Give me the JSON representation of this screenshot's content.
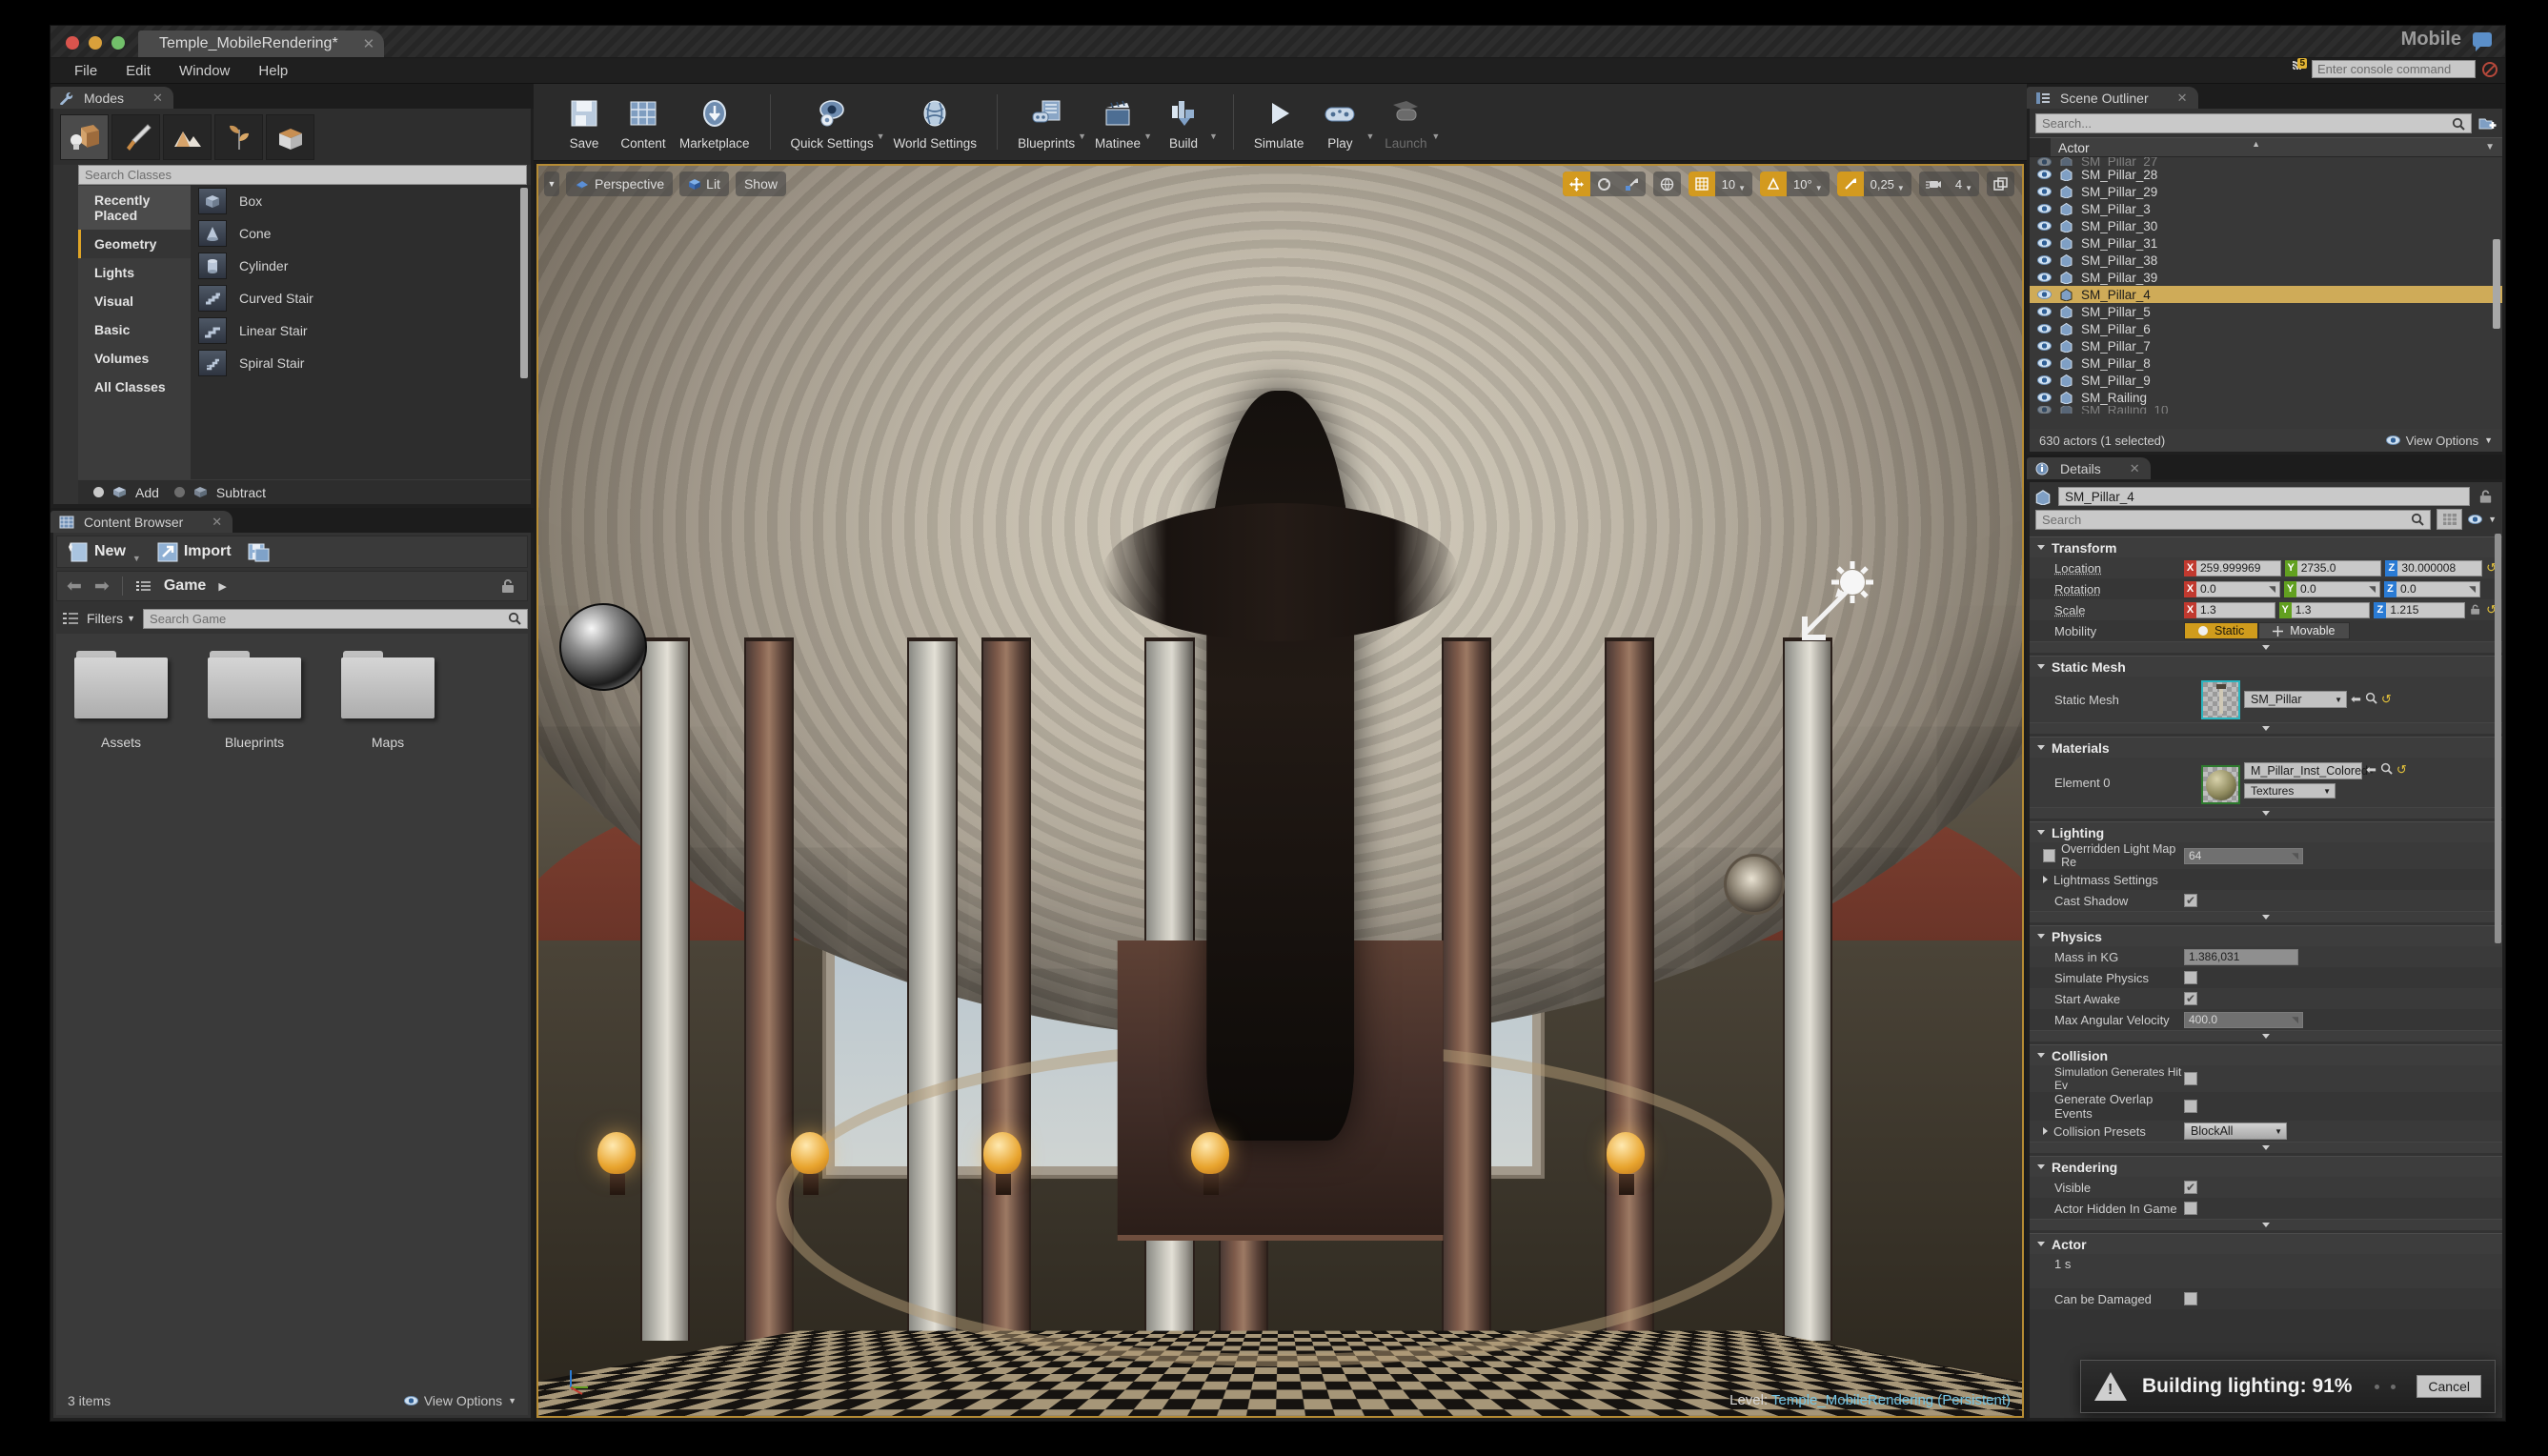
{
  "window": {
    "project_tab": "Temple_MobileRendering*",
    "close_glyph": "✕",
    "mobile_label": "Mobile"
  },
  "menubar": {
    "items": [
      "File",
      "Edit",
      "Window",
      "Help"
    ],
    "network_badge": "5",
    "console_placeholder": "Enter console command"
  },
  "modes": {
    "tab_label": "Modes",
    "search_placeholder": "Search Classes",
    "mode_icons": [
      "place-mode-icon",
      "paint-mode-icon",
      "landscape-mode-icon",
      "foliage-mode-icon",
      "geometry-editing-mode-icon"
    ],
    "categories": [
      {
        "label": "Recently Placed",
        "state": "recent"
      },
      {
        "label": "Geometry",
        "state": "selected"
      },
      {
        "label": "Lights",
        "state": "normal"
      },
      {
        "label": "Visual",
        "state": "normal"
      },
      {
        "label": "Basic",
        "state": "normal"
      },
      {
        "label": "Volumes",
        "state": "normal"
      },
      {
        "label": "All Classes",
        "state": "normal"
      }
    ],
    "items": [
      {
        "label": "Box"
      },
      {
        "label": "Cone"
      },
      {
        "label": "Cylinder"
      },
      {
        "label": "Curved Stair"
      },
      {
        "label": "Linear Stair"
      },
      {
        "label": "Spiral Stair"
      }
    ],
    "brush_add": "Add",
    "brush_subtract": "Subtract"
  },
  "content_browser": {
    "tab_label": "Content Browser",
    "new_label": "New",
    "import_label": "Import",
    "save_all_icon": "save-all-icon",
    "breadcrumb": "Game",
    "filters_label": "Filters",
    "search_placeholder": "Search Game",
    "folders": [
      {
        "label": "Assets"
      },
      {
        "label": "Blueprints"
      },
      {
        "label": "Maps"
      }
    ],
    "item_count": "3 items",
    "view_options": "View Options"
  },
  "toolbar": {
    "groups": [
      [
        {
          "label": "Save",
          "icon": "save-icon",
          "caret": false,
          "dim": false
        },
        {
          "label": "Content",
          "icon": "content-icon",
          "caret": false,
          "dim": false
        },
        {
          "label": "Marketplace",
          "icon": "marketplace-icon",
          "caret": false,
          "dim": false
        }
      ],
      [
        {
          "label": "Quick Settings",
          "icon": "quick-settings-icon",
          "caret": true,
          "dim": false
        },
        {
          "label": "World Settings",
          "icon": "world-settings-icon",
          "caret": false,
          "dim": false
        }
      ],
      [
        {
          "label": "Blueprints",
          "icon": "blueprints-icon",
          "caret": true,
          "dim": false
        },
        {
          "label": "Matinee",
          "icon": "matinee-icon",
          "caret": true,
          "dim": false
        },
        {
          "label": "Build",
          "icon": "build-icon",
          "caret": true,
          "dim": false
        }
      ],
      [
        {
          "label": "Simulate",
          "icon": "simulate-icon",
          "caret": false,
          "dim": false
        },
        {
          "label": "Play",
          "icon": "play-icon",
          "caret": true,
          "dim": false
        },
        {
          "label": "Launch",
          "icon": "launch-icon",
          "caret": true,
          "dim": true
        }
      ]
    ]
  },
  "viewport": {
    "view_mode": "Perspective",
    "lighting_mode": "Lit",
    "show_label": "Show",
    "transform_widgets": [
      "translate-gizmo-icon",
      "rotate-gizmo-icon",
      "scale-gizmo-icon"
    ],
    "coord_system": "world-coords-icon",
    "grid_snap_value": "10",
    "rotation_snap_value": "10°",
    "scale_snap_value": "0,25",
    "camera_speed_value": "4",
    "maximize_icon": "maximize-viewport-icon",
    "level_key": "Level:",
    "level_value": "Temple_MobileRendering (Persistent)"
  },
  "outliner": {
    "tab_label": "Scene Outliner",
    "search_placeholder": "Search...",
    "column_header": "Actor",
    "rows": [
      {
        "name": "SM_Pillar_27",
        "selected": false,
        "partial": true
      },
      {
        "name": "SM_Pillar_28",
        "selected": false,
        "partial": false
      },
      {
        "name": "SM_Pillar_29",
        "selected": false,
        "partial": false
      },
      {
        "name": "SM_Pillar_3",
        "selected": false,
        "partial": false
      },
      {
        "name": "SM_Pillar_30",
        "selected": false,
        "partial": false
      },
      {
        "name": "SM_Pillar_31",
        "selected": false,
        "partial": false
      },
      {
        "name": "SM_Pillar_38",
        "selected": false,
        "partial": false
      },
      {
        "name": "SM_Pillar_39",
        "selected": false,
        "partial": false
      },
      {
        "name": "SM_Pillar_4",
        "selected": true,
        "partial": false
      },
      {
        "name": "SM_Pillar_5",
        "selected": false,
        "partial": false
      },
      {
        "name": "SM_Pillar_6",
        "selected": false,
        "partial": false
      },
      {
        "name": "SM_Pillar_7",
        "selected": false,
        "partial": false
      },
      {
        "name": "SM_Pillar_8",
        "selected": false,
        "partial": false
      },
      {
        "name": "SM_Pillar_9",
        "selected": false,
        "partial": false
      },
      {
        "name": "SM_Railing",
        "selected": false,
        "partial": false
      },
      {
        "name": "SM_Railing_10",
        "selected": false,
        "partial": true
      }
    ],
    "status": "630 actors (1 selected)",
    "view_options": "View Options"
  },
  "details": {
    "tab_label": "Details",
    "actor_name": "SM_Pillar_4",
    "search_placeholder": "Search",
    "sections": {
      "transform": {
        "title": "Transform",
        "location_label": "Location",
        "location": {
          "x": "259.999969",
          "y": "2735.0",
          "z": "30.000008"
        },
        "rotation_label": "Rotation",
        "rotation": {
          "x": "0.0",
          "y": "0.0",
          "z": "0.0"
        },
        "scale_label": "Scale",
        "scale": {
          "x": "1.3",
          "y": "1.3",
          "z": "1.215"
        },
        "mobility_label": "Mobility",
        "mobility_static": "Static",
        "mobility_movable": "Movable",
        "mobility_selected": "Static"
      },
      "static_mesh": {
        "title": "Static Mesh",
        "row_label": "Static Mesh",
        "value": "SM_Pillar"
      },
      "materials": {
        "title": "Materials",
        "row_label": "Element 0",
        "value": "M_Pillar_Inst_Colored",
        "textures_label": "Textures"
      },
      "lighting": {
        "title": "Lighting",
        "overridden_label": "Overridden Light Map Re",
        "overridden_value": "64",
        "overridden_checked": false,
        "lightmass_label": "Lightmass Settings",
        "cast_shadow_label": "Cast Shadow",
        "cast_shadow_checked": true
      },
      "physics": {
        "title": "Physics",
        "mass_label": "Mass in KG",
        "mass_value": "1.386,031",
        "simulate_label": "Simulate Physics",
        "simulate_checked": false,
        "start_awake_label": "Start Awake",
        "start_awake_checked": true,
        "max_angular_label": "Max Angular Velocity",
        "max_angular_value": "400.0"
      },
      "collision": {
        "title": "Collision",
        "hit_events_label": "Simulation Generates Hit Ev",
        "hit_events_checked": false,
        "overlap_label": "Generate Overlap Events",
        "overlap_checked": false,
        "presets_label": "Collision Presets",
        "presets_value": "BlockAll"
      },
      "rendering": {
        "title": "Rendering",
        "visible_label": "Visible",
        "visible_checked": true,
        "hidden_label": "Actor Hidden In Game",
        "hidden_checked": false
      },
      "actor": {
        "title": "Actor",
        "first_line": "1 s",
        "can_be_damaged_label": "Can be Damaged"
      }
    }
  },
  "toast": {
    "message": "Building lighting:  91%",
    "cancel_label": "Cancel"
  },
  "colors": {
    "accent_orange": "#d09c1c",
    "selection": "#cfab58",
    "viewport_border": "#b58b34",
    "axis_x": "#c1392f",
    "axis_y": "#62a020",
    "axis_z": "#2a7bd4"
  }
}
